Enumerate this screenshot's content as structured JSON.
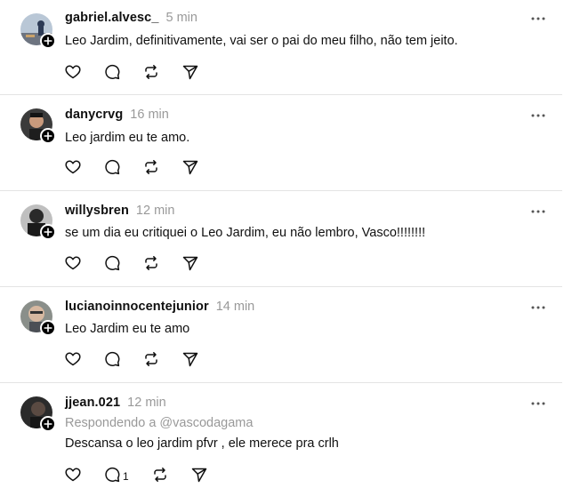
{
  "posts": [
    {
      "username": "gabriel.alvesc_",
      "time": "5 min",
      "reply_context": "",
      "text": "Leo Jardim, definitivamente, vai ser o pai do meu filho, não tem jeito.",
      "reply_count": "",
      "avatar_icon": "avatar-photo"
    },
    {
      "username": "danycrvg",
      "time": "16 min",
      "reply_context": "",
      "text": "Leo jardim eu te amo.",
      "reply_count": "",
      "avatar_icon": "avatar-photo"
    },
    {
      "username": "willysbren",
      "time": "12 min",
      "reply_context": "",
      "text": "se um dia eu critiquei o Leo Jardim, eu não lembro, Vasco!!!!!!!!",
      "reply_count": "",
      "avatar_icon": "avatar-photo"
    },
    {
      "username": "lucianoinnocentejunior",
      "time": "14 min",
      "reply_context": "",
      "text": "Leo Jardim eu te amo",
      "reply_count": "",
      "avatar_icon": "avatar-photo"
    },
    {
      "username": "jjean.021",
      "time": "12 min",
      "reply_context": "Respondendo a @vascodagama",
      "text": "Descansa o leo jardim pfvr , ele merece pra crlh",
      "reply_count": "1",
      "avatar_icon": "avatar-photo"
    }
  ],
  "icons": {
    "like": "heart-icon",
    "reply": "comment-icon",
    "repost": "repost-icon",
    "share": "send-icon",
    "more": "more-options-icon",
    "follow": "plus-icon"
  },
  "colors": {
    "text": "#101010",
    "muted": "#999999",
    "divider": "#e3e3e3",
    "background": "#ffffff"
  }
}
